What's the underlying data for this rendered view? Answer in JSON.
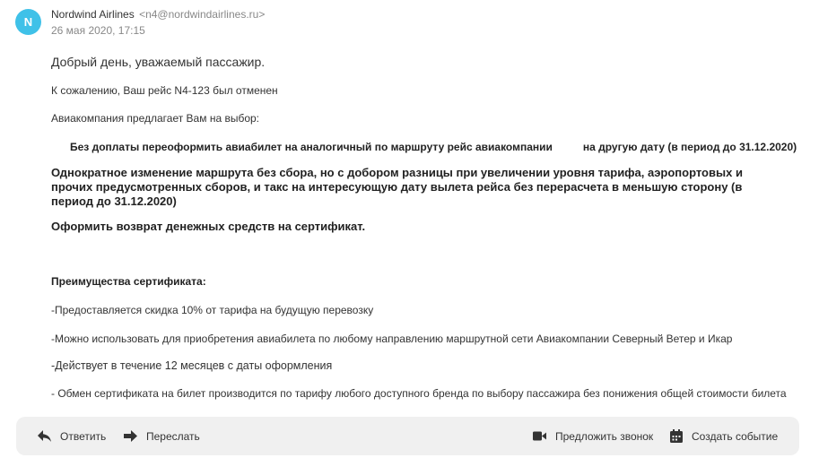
{
  "message": {
    "avatar_letter": "N",
    "sender_name": "Nordwind Airlines",
    "sender_email": "<n4@nordwindairlines.ru>",
    "date": "26 мая 2020, 17:15",
    "greeting": "Добрый день, уважаемый пассажир.",
    "line1": "К сожалению, Ваш рейс N4-123 был отменен",
    "line2": "Авиакомпания предлагает Вам на выбор:",
    "option1_a": "Без доплаты переоформить авиабилет на аналогичный по маршруту рейс авиакомпании",
    "option1_b": "на другую дату (в период до 31.12.2020)",
    "option2": "Однократное изменение маршрута без сбора, но с добором разницы при увеличении уровня тарифа, аэропортовых и прочих предусмотренных сборов, и такс на интересующую дату вылета рейса без перерасчета в меньшую сторону (в период до 31.12.2020)",
    "option3": "Оформить возврат денежных средств на сертификат.",
    "advantages_title": "Преимущества сертификата:",
    "adv1": "-Предоставляется скидка 10% от тарифа на будущую перевозку",
    "adv2": "-Можно использовать для приобретения авиабилета по любому направлению маршрутной сети Авиакомпании Северный Ветер и Икар",
    "adv3": "-Действует в течение 12 месяцев с даты оформления",
    "adv4": "- Обмен сертификата на билет производится по тарифу любого доступного бренда по выбору пассажира без понижения общей стоимости билета"
  },
  "toolbar": {
    "reply_label": "Ответить",
    "forward_label": "Переслать",
    "call_label": "Предложить звонок",
    "event_label": "Создать событие"
  },
  "colors": {
    "avatar": "#3fc1e8",
    "toolbar_bg": "#f0f0f0"
  }
}
